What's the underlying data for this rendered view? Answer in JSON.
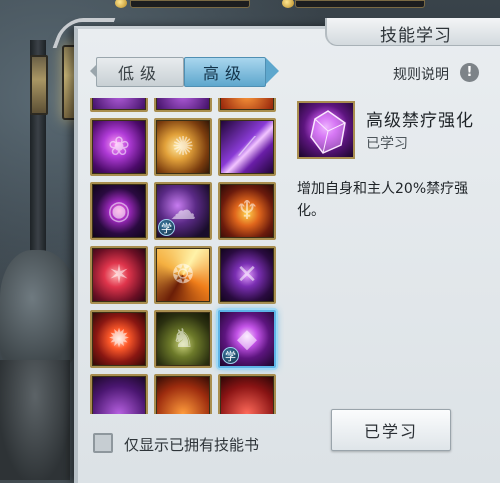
{
  "window": {
    "title": "技能学习"
  },
  "tabs": [
    {
      "label": "低级",
      "active": false
    },
    {
      "label": "高级",
      "active": true
    }
  ],
  "rules": {
    "label": "规则说明",
    "help_glyph": "!"
  },
  "skills": [
    {
      "art": "peek-purple",
      "learned": false
    },
    {
      "art": "peek-purple",
      "learned": false
    },
    {
      "art": "peek-fire",
      "learned": false
    },
    {
      "art": "purple-dragon",
      "learned": false
    },
    {
      "art": "gold-beam",
      "learned": false
    },
    {
      "art": "violet-slash",
      "learned": false
    },
    {
      "art": "dark-orb",
      "learned": false
    },
    {
      "art": "blue-smoke",
      "learned": true
    },
    {
      "art": "fire-demon",
      "learned": false
    },
    {
      "art": "red-claw",
      "learned": false
    },
    {
      "art": "orange-swirl",
      "learned": false
    },
    {
      "art": "purple-x",
      "learned": false
    },
    {
      "art": "red-burst",
      "learned": false
    },
    {
      "art": "green-beast",
      "learned": false
    },
    {
      "art": "crystal",
      "learned": true,
      "selected": true
    },
    {
      "art": "peek-purple",
      "learned": false
    },
    {
      "art": "peek-fire",
      "learned": false
    },
    {
      "art": "peek-red",
      "learned": false
    }
  ],
  "learn_badge": "学",
  "detail": {
    "name": "高级禁疗强化",
    "state": "已学习",
    "description": "增加自身和主人20%禁疗强化。",
    "action_label": "已学习"
  },
  "filter": {
    "label": "仅显示已拥有技能书",
    "checked": false
  },
  "colors": {
    "accent_tab": "#5ea7cd",
    "frame_gold": "#a98e4f",
    "selected_glow": "#5db4e6"
  }
}
